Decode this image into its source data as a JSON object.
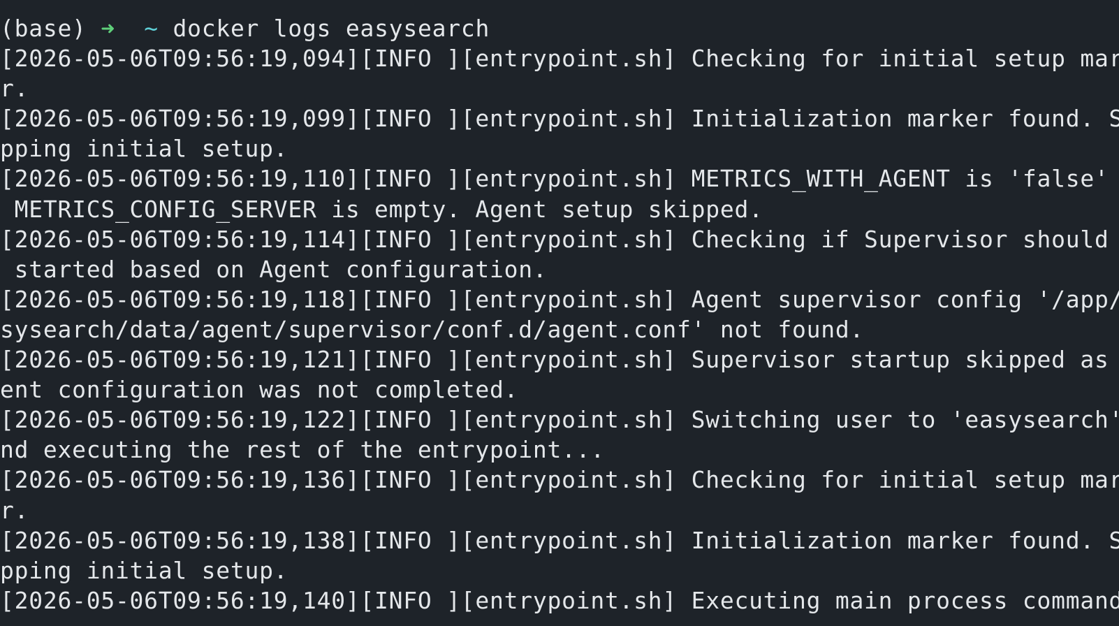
{
  "colors": {
    "background": "#1e2329",
    "text": "#e4e7ea",
    "prompt_arrow": "#5fd07a",
    "prompt_dir": "#5fd0d7"
  },
  "prompt": {
    "env": "(base)",
    "arrow": "➜",
    "dir": "~",
    "command": "docker logs easysearch"
  },
  "output_lines": [
    "[2026-05-06T09:56:19,094][INFO ][entrypoint.sh] Checking for initial setup marke",
    "r.",
    "[2026-05-06T09:56:19,099][INFO ][entrypoint.sh] Initialization marker found. Ski",
    "pping initial setup.",
    "[2026-05-06T09:56:19,110][INFO ][entrypoint.sh] METRICS_WITH_AGENT is 'false' or",
    " METRICS_CONFIG_SERVER is empty. Agent setup skipped.",
    "[2026-05-06T09:56:19,114][INFO ][entrypoint.sh] Checking if Supervisor should be",
    " started based on Agent configuration.",
    "[2026-05-06T09:56:19,118][INFO ][entrypoint.sh] Agent supervisor config '/app/ea",
    "sysearch/data/agent/supervisor/conf.d/agent.conf' not found.",
    "[2026-05-06T09:56:19,121][INFO ][entrypoint.sh] Supervisor startup skipped as Ag",
    "ent configuration was not completed.",
    "[2026-05-06T09:56:19,122][INFO ][entrypoint.sh] Switching user to 'easysearch' a",
    "nd executing the rest of the entrypoint...",
    "[2026-05-06T09:56:19,136][INFO ][entrypoint.sh] Checking for initial setup marke",
    "r.",
    "[2026-05-06T09:56:19,138][INFO ][entrypoint.sh] Initialization marker found. Ski",
    "pping initial setup.",
    "[2026-05-06T09:56:19,140][INFO ][entrypoint.sh] Executing main process command:"
  ]
}
